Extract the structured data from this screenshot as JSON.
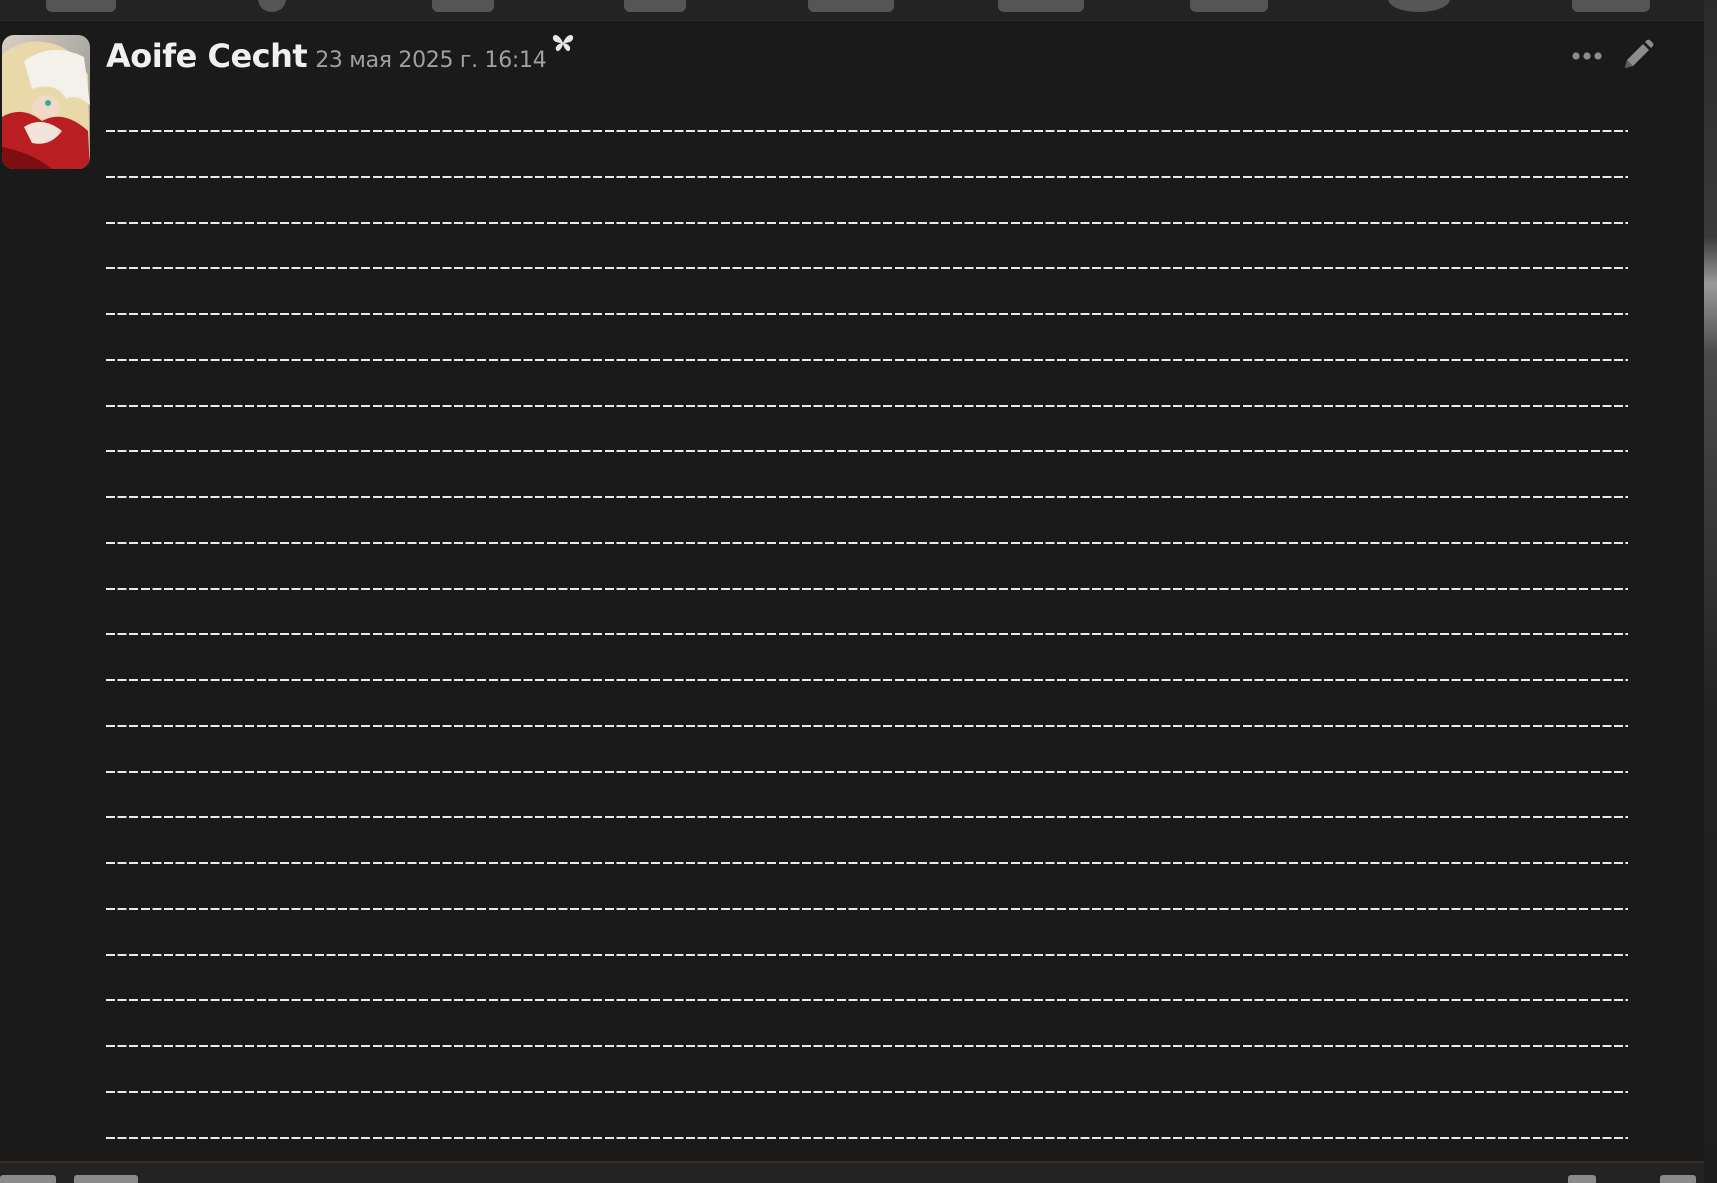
{
  "message": {
    "author": "Aoife Cecht",
    "timestamp": "23 мая 2025 г. 16:14",
    "badge_icon": "butterfly-icon",
    "lines": [
      "----------------------------------------------------------------------------------------------------------------------------------",
      "----------------------------------------------------------------------------------------------------------------------------------",
      "----------------------------------------------------------------------------------------------------------------------------------",
      "----------------------------------------------------------------------------------------------------------------------------------",
      "----------------------------------------------------------------------------------------------------------------------------------",
      "----------------------------------------------------------------------------------------------------------------------------------",
      "----------------------------------------------------------------------------------------------------------------------------------",
      "----------------------------------------------------------------------------------------------------------------------------------",
      "----------------------------------------------------------------------------------------------------------------------------------",
      "----------------------------------------------------------------------------------------------------------------------------------",
      "----------------------------------------------------------------------------------------------------------------------------------",
      "----------------------------------------------------------------------------------------------------------------------------------",
      "----------------------------------------------------------------------------------------------------------------------------------",
      "----------------------------------------------------------------------------------------------------------------------------------",
      "----------------------------------------------------------------------------------------------------------------------------------",
      "----------------------------------------------------------------------------------------------------------------------------------",
      "----------------------------------------------------------------------------------------------------------------------------------",
      "----------------------------------------------------------------------------------------------------------------------------------",
      "----------------------------------------------------------------------------------------------------------------------------------",
      "----------------------------------------------------------------------------------------------------------------------------------",
      "----------------------------------------------------------------------------------------------------------------------------------",
      "----------------------------------------------------------------------------------------------------------------------------------",
      "----------------------------------------------------------------------------------------------------------------------------------"
    ]
  },
  "actions": {
    "more_icon": "more-horizontal-icon",
    "edit_icon": "pencil-icon"
  },
  "colors": {
    "background": "#1a1a1a",
    "author": "#f0f0f0",
    "timestamp": "#a0a0a0",
    "text": "#e9e9e9"
  }
}
